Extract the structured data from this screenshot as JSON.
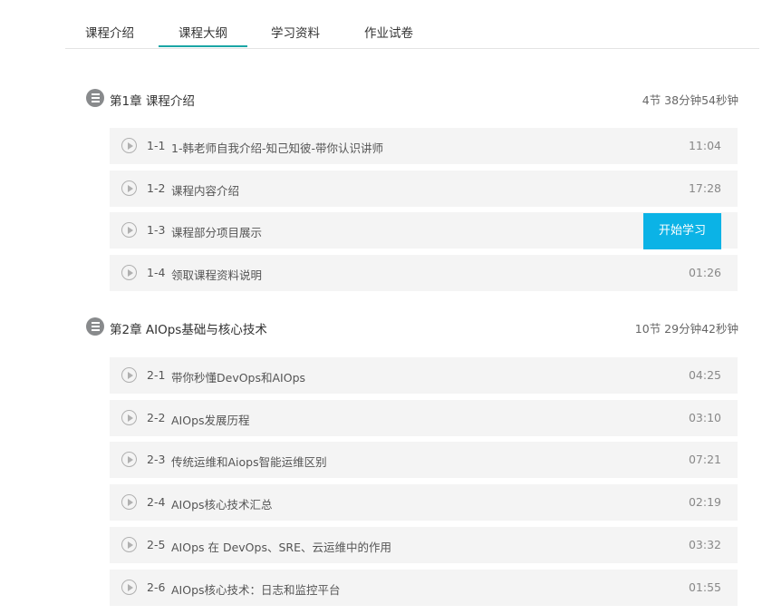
{
  "tabs": [
    {
      "label": "课程介绍"
    },
    {
      "label": "课程大纲"
    },
    {
      "label": "学习资料"
    },
    {
      "label": "作业试卷"
    }
  ],
  "chapters": [
    {
      "title": "第1章  课程介绍",
      "meta": "4节 38分钟54秒钟",
      "lessons": [
        {
          "num": "1-1",
          "title": "1-韩老师自我介绍-知己知彼-带你认识讲师",
          "duration": "11:04"
        },
        {
          "num": "1-2",
          "title": "课程内容介绍",
          "duration": "17:28"
        },
        {
          "num": "1-3",
          "title": "课程部分项目展示",
          "button": "开始学习"
        },
        {
          "num": "1-4",
          "title": "领取课程资料说明",
          "duration": "01:26"
        }
      ]
    },
    {
      "title": "第2章  AIOps基础与核心技术",
      "meta": "10节 29分钟42秒钟",
      "lessons": [
        {
          "num": "2-1",
          "title": "带你秒懂DevOps和AIOps",
          "duration": "04:25"
        },
        {
          "num": "2-2",
          "title": "AIOps发展历程",
          "duration": "03:10"
        },
        {
          "num": "2-3",
          "title": "传统运维和Aiops智能运维区别",
          "duration": "07:21"
        },
        {
          "num": "2-4",
          "title": "AIOps核心技术汇总",
          "duration": "02:19"
        },
        {
          "num": "2-5",
          "title": "AIOps 在 DevOps、SRE、云运维中的作用",
          "duration": "03:32"
        },
        {
          "num": "2-6",
          "title": "AIOps核心技术：日志和监控平台",
          "duration": "01:55"
        }
      ]
    }
  ],
  "colors": {
    "accent": "#0bb3e6",
    "tab_underline": "#1aa5a5",
    "row_bg": "#f4f4f4"
  },
  "icons": {
    "chapter": "list-icon",
    "lesson": "play-circle-icon"
  }
}
